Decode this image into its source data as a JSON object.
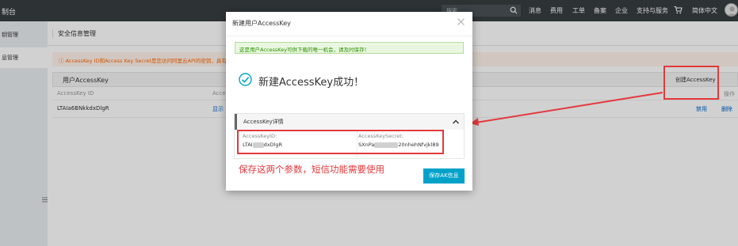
{
  "topbar": {
    "brand": "制台",
    "search_placeholder": "搜索",
    "nav": [
      "消息",
      "费用",
      "工单",
      "备案",
      "企业",
      "支持与服务",
      "简体中文"
    ]
  },
  "sidebar": {
    "items": [
      "钥管理",
      "息管理"
    ]
  },
  "main": {
    "title": "安全信息管理",
    "warning": "ⓘ AccessKey ID和Access Key Secret是您访问阿里云API的密钥，具有该账",
    "panel_title": "用户AccessKey",
    "create_button": "创建AccessKey",
    "columns": {
      "id": "AccessKey ID",
      "secret": "Access",
      "ops": "操作"
    },
    "row": {
      "key_id": "LTAIa6BNkkdxDlgR",
      "show_link": "显示",
      "disable_link": "禁用",
      "delete_link": "删除"
    }
  },
  "modal": {
    "title": "新建用户AccessKey",
    "tip": "这是用户AccessKey可供下载的唯一机会，请及时保存！",
    "success_heading": "新建AccessKey成功！",
    "details_title": "AccessKey详情",
    "id_label": "AccessKeyID:",
    "id_prefix": "LTAI",
    "id_suffix": "dxDlgR",
    "secret_label": "AccessKeySecret:",
    "secret_prefix": "SXnPa",
    "secret_suffix": "20nhehNfvjkl89",
    "annotation": "保存这两个参数，短信功能需要使用",
    "save_button": "保存AK信息"
  },
  "colors": {
    "accent": "#00a2ca",
    "highlight": "#e4393c",
    "topbar": "#373d41",
    "success": "#2b8f00"
  },
  "icons": [
    "search-icon",
    "cart-icon",
    "close-icon",
    "check-circle-icon",
    "chevron-up-icon",
    "menu-toggle-icon"
  ]
}
